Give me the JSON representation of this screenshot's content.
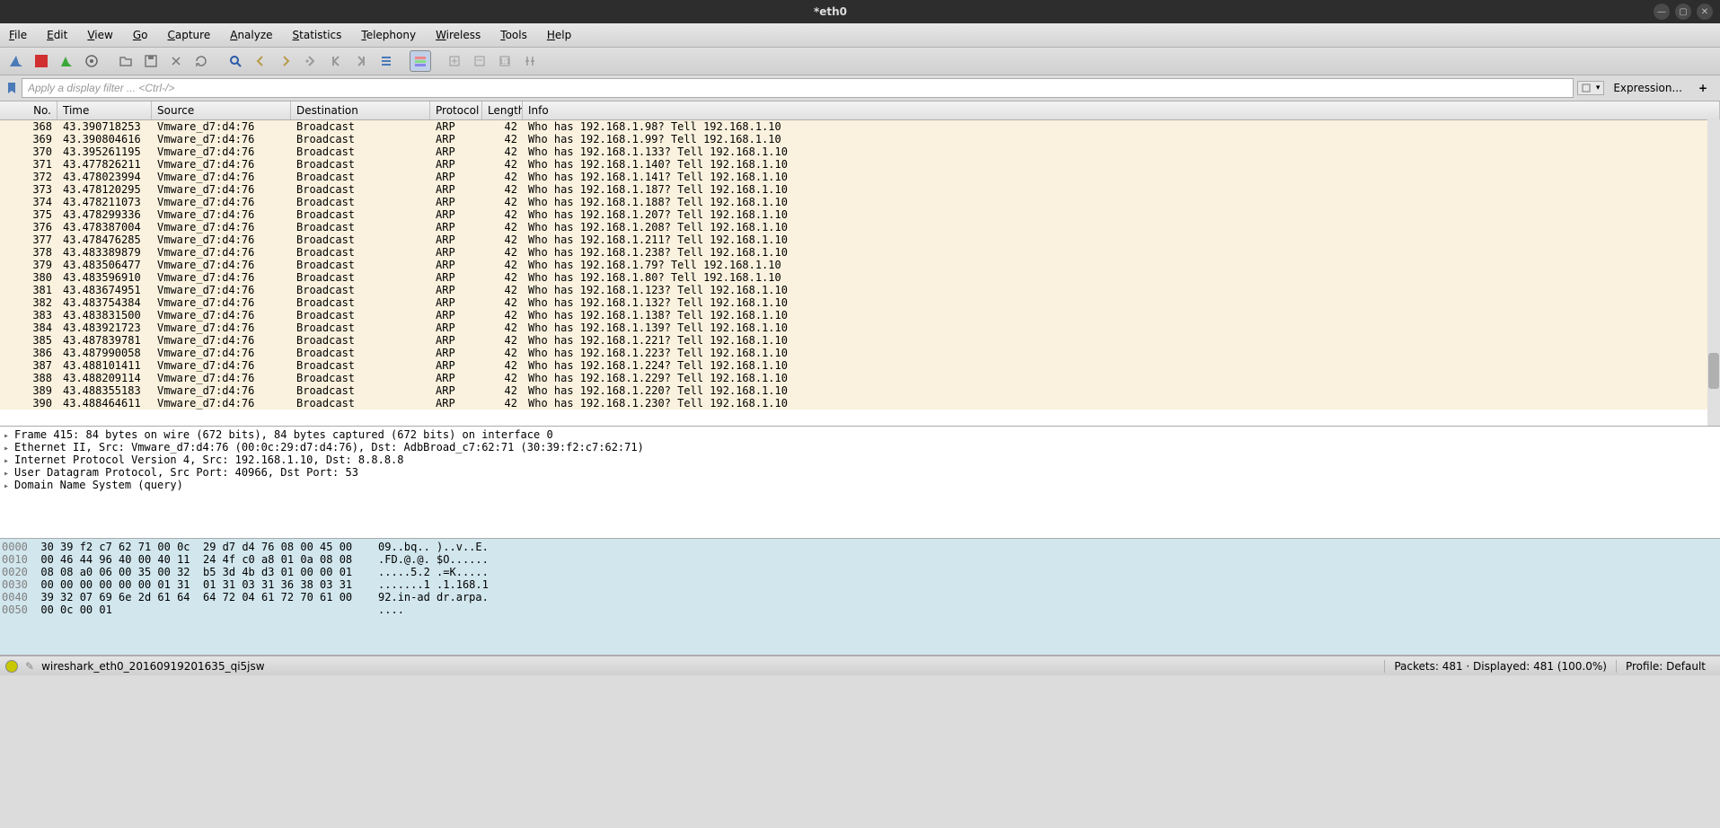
{
  "title": "*eth0",
  "menu": [
    "File",
    "Edit",
    "View",
    "Go",
    "Capture",
    "Analyze",
    "Statistics",
    "Telephony",
    "Wireless",
    "Tools",
    "Help"
  ],
  "filter_placeholder": "Apply a display filter ... <Ctrl-/>",
  "expression_label": "Expression...",
  "columns": [
    "No.",
    "Time",
    "Source",
    "Destination",
    "Protocol",
    "Length",
    "Info"
  ],
  "packets": [
    {
      "no": 368,
      "time": "43.390718253",
      "src": "Vmware_d7:d4:76",
      "dst": "Broadcast",
      "proto": "ARP",
      "len": 42,
      "info": "Who has 192.168.1.98? Tell 192.168.1.10"
    },
    {
      "no": 369,
      "time": "43.390804616",
      "src": "Vmware_d7:d4:76",
      "dst": "Broadcast",
      "proto": "ARP",
      "len": 42,
      "info": "Who has 192.168.1.99? Tell 192.168.1.10"
    },
    {
      "no": 370,
      "time": "43.395261195",
      "src": "Vmware_d7:d4:76",
      "dst": "Broadcast",
      "proto": "ARP",
      "len": 42,
      "info": "Who has 192.168.1.133? Tell 192.168.1.10"
    },
    {
      "no": 371,
      "time": "43.477826211",
      "src": "Vmware_d7:d4:76",
      "dst": "Broadcast",
      "proto": "ARP",
      "len": 42,
      "info": "Who has 192.168.1.140? Tell 192.168.1.10"
    },
    {
      "no": 372,
      "time": "43.478023994",
      "src": "Vmware_d7:d4:76",
      "dst": "Broadcast",
      "proto": "ARP",
      "len": 42,
      "info": "Who has 192.168.1.141? Tell 192.168.1.10"
    },
    {
      "no": 373,
      "time": "43.478120295",
      "src": "Vmware_d7:d4:76",
      "dst": "Broadcast",
      "proto": "ARP",
      "len": 42,
      "info": "Who has 192.168.1.187? Tell 192.168.1.10"
    },
    {
      "no": 374,
      "time": "43.478211073",
      "src": "Vmware_d7:d4:76",
      "dst": "Broadcast",
      "proto": "ARP",
      "len": 42,
      "info": "Who has 192.168.1.188? Tell 192.168.1.10"
    },
    {
      "no": 375,
      "time": "43.478299336",
      "src": "Vmware_d7:d4:76",
      "dst": "Broadcast",
      "proto": "ARP",
      "len": 42,
      "info": "Who has 192.168.1.207? Tell 192.168.1.10"
    },
    {
      "no": 376,
      "time": "43.478387004",
      "src": "Vmware_d7:d4:76",
      "dst": "Broadcast",
      "proto": "ARP",
      "len": 42,
      "info": "Who has 192.168.1.208? Tell 192.168.1.10"
    },
    {
      "no": 377,
      "time": "43.478476285",
      "src": "Vmware_d7:d4:76",
      "dst": "Broadcast",
      "proto": "ARP",
      "len": 42,
      "info": "Who has 192.168.1.211? Tell 192.168.1.10"
    },
    {
      "no": 378,
      "time": "43.483389879",
      "src": "Vmware_d7:d4:76",
      "dst": "Broadcast",
      "proto": "ARP",
      "len": 42,
      "info": "Who has 192.168.1.238? Tell 192.168.1.10"
    },
    {
      "no": 379,
      "time": "43.483506477",
      "src": "Vmware_d7:d4:76",
      "dst": "Broadcast",
      "proto": "ARP",
      "len": 42,
      "info": "Who has 192.168.1.79? Tell 192.168.1.10"
    },
    {
      "no": 380,
      "time": "43.483596910",
      "src": "Vmware_d7:d4:76",
      "dst": "Broadcast",
      "proto": "ARP",
      "len": 42,
      "info": "Who has 192.168.1.80? Tell 192.168.1.10"
    },
    {
      "no": 381,
      "time": "43.483674951",
      "src": "Vmware_d7:d4:76",
      "dst": "Broadcast",
      "proto": "ARP",
      "len": 42,
      "info": "Who has 192.168.1.123? Tell 192.168.1.10"
    },
    {
      "no": 382,
      "time": "43.483754384",
      "src": "Vmware_d7:d4:76",
      "dst": "Broadcast",
      "proto": "ARP",
      "len": 42,
      "info": "Who has 192.168.1.132? Tell 192.168.1.10"
    },
    {
      "no": 383,
      "time": "43.483831500",
      "src": "Vmware_d7:d4:76",
      "dst": "Broadcast",
      "proto": "ARP",
      "len": 42,
      "info": "Who has 192.168.1.138? Tell 192.168.1.10"
    },
    {
      "no": 384,
      "time": "43.483921723",
      "src": "Vmware_d7:d4:76",
      "dst": "Broadcast",
      "proto": "ARP",
      "len": 42,
      "info": "Who has 192.168.1.139? Tell 192.168.1.10"
    },
    {
      "no": 385,
      "time": "43.487839781",
      "src": "Vmware_d7:d4:76",
      "dst": "Broadcast",
      "proto": "ARP",
      "len": 42,
      "info": "Who has 192.168.1.221? Tell 192.168.1.10"
    },
    {
      "no": 386,
      "time": "43.487990058",
      "src": "Vmware_d7:d4:76",
      "dst": "Broadcast",
      "proto": "ARP",
      "len": 42,
      "info": "Who has 192.168.1.223? Tell 192.168.1.10"
    },
    {
      "no": 387,
      "time": "43.488101411",
      "src": "Vmware_d7:d4:76",
      "dst": "Broadcast",
      "proto": "ARP",
      "len": 42,
      "info": "Who has 192.168.1.224? Tell 192.168.1.10"
    },
    {
      "no": 388,
      "time": "43.488209114",
      "src": "Vmware_d7:d4:76",
      "dst": "Broadcast",
      "proto": "ARP",
      "len": 42,
      "info": "Who has 192.168.1.229? Tell 192.168.1.10"
    },
    {
      "no": 389,
      "time": "43.488355183",
      "src": "Vmware_d7:d4:76",
      "dst": "Broadcast",
      "proto": "ARP",
      "len": 42,
      "info": "Who has 192.168.1.220? Tell 192.168.1.10"
    },
    {
      "no": 390,
      "time": "43.488464611",
      "src": "Vmware_d7:d4:76",
      "dst": "Broadcast",
      "proto": "ARP",
      "len": 42,
      "info": "Who has 192.168.1.230? Tell 192.168.1.10"
    }
  ],
  "details": [
    "Frame 415: 84 bytes on wire (672 bits), 84 bytes captured (672 bits) on interface 0",
    "Ethernet II, Src: Vmware_d7:d4:76 (00:0c:29:d7:d4:76), Dst: AdbBroad_c7:62:71 (30:39:f2:c7:62:71)",
    "Internet Protocol Version 4, Src: 192.168.1.10, Dst: 8.8.8.8",
    "User Datagram Protocol, Src Port: 40966, Dst Port: 53",
    "Domain Name System (query)"
  ],
  "hex": [
    {
      "off": "0000",
      "b": "30 39 f2 c7 62 71 00 0c  29 d7 d4 76 08 00 45 00",
      "a": "09..bq.. )..v..E."
    },
    {
      "off": "0010",
      "b": "00 46 44 96 40 00 40 11  24 4f c0 a8 01 0a 08 08",
      "a": ".FD.@.@. $O......"
    },
    {
      "off": "0020",
      "b": "08 08 a0 06 00 35 00 32  b5 3d 4b d3 01 00 00 01",
      "a": ".....5.2 .=K....."
    },
    {
      "off": "0030",
      "b": "00 00 00 00 00 00 01 31  01 31 03 31 36 38 03 31",
      "a": ".......1 .1.168.1"
    },
    {
      "off": "0040",
      "b": "39 32 07 69 6e 2d 61 64  64 72 04 61 72 70 61 00",
      "a": "92.in-ad dr.arpa."
    },
    {
      "off": "0050",
      "b": "00 0c 00 01",
      "a": "...."
    }
  ],
  "status": {
    "file": "wireshark_eth0_20160919201635_qi5jsw",
    "packets": "Packets: 481 · Displayed: 481 (100.0%)",
    "profile": "Profile: Default"
  }
}
